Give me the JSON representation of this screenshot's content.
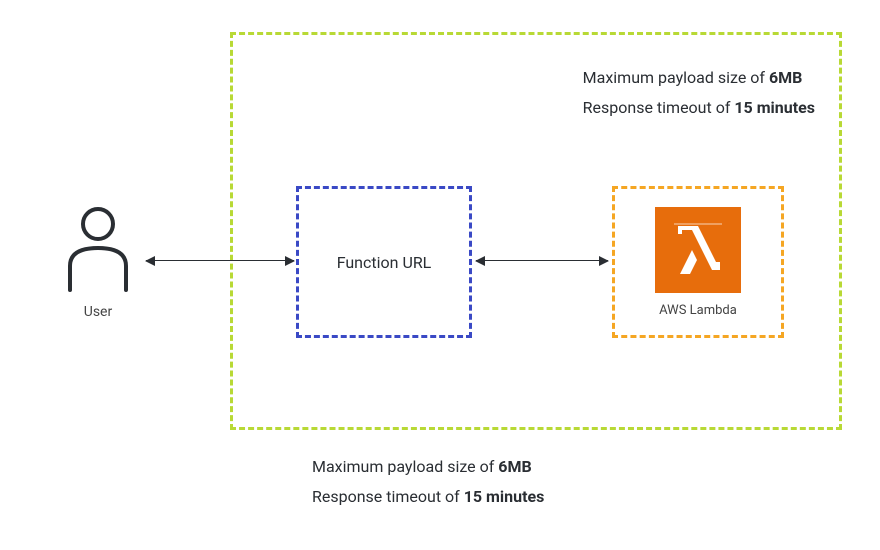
{
  "user": {
    "label": "User"
  },
  "functionUrl": {
    "label": "Function URL"
  },
  "lambda": {
    "label": "AWS Lambda"
  },
  "limits": {
    "payload_prefix": "Maximum payload size of ",
    "payload_value": "6MB",
    "timeout_prefix": "Response timeout of ",
    "timeout_value": "15 minutes"
  },
  "colors": {
    "outer_border": "#b8d935",
    "function_border": "#3a49c5",
    "lambda_border": "#f5a623",
    "lambda_fill": "#e76d0c"
  }
}
